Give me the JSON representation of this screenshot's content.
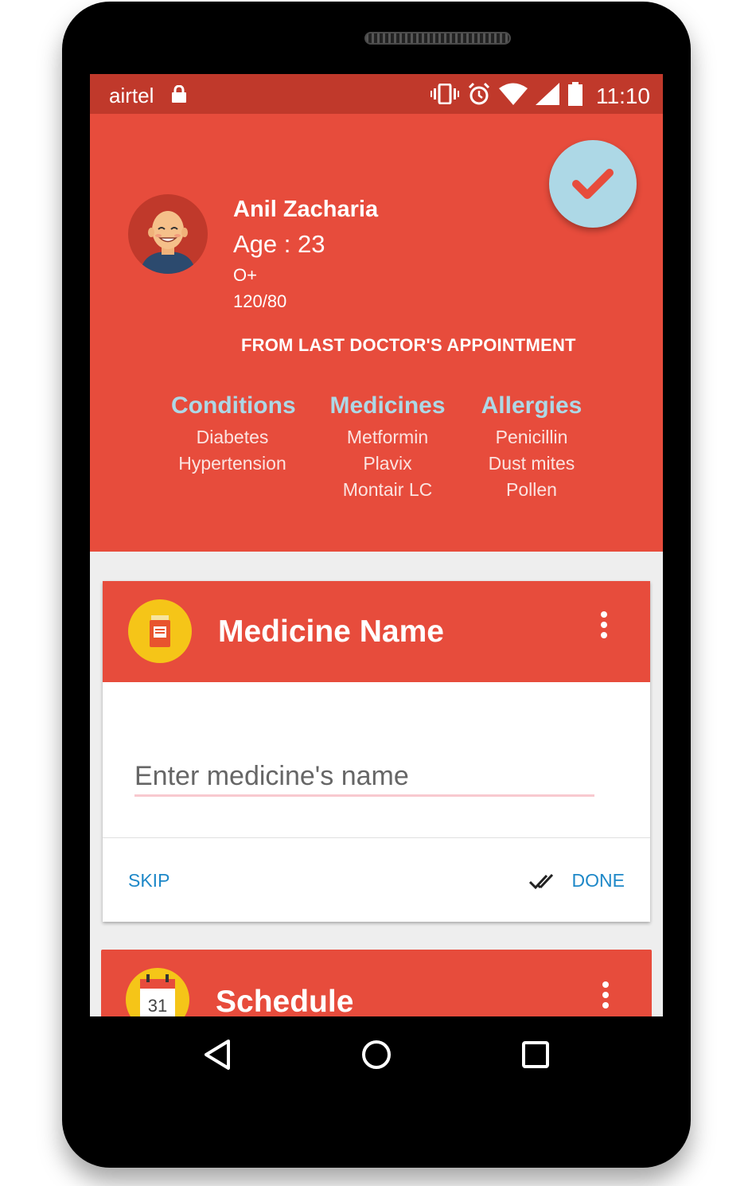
{
  "status_bar": {
    "carrier": "airtel",
    "time": "11:10",
    "icons": [
      "lock-icon",
      "vibrate-icon",
      "alarm-icon",
      "wifi-icon",
      "signal-icon",
      "battery-icon"
    ]
  },
  "profile": {
    "name": "Anil Zacharia",
    "age": "Age : 23",
    "blood_group": "O+",
    "blood_pressure": "120/80",
    "section_label": "FROM LAST DOCTOR'S APPOINTMENT"
  },
  "summary": {
    "conditions": {
      "title": "Conditions",
      "items": [
        "Diabetes",
        "Hypertension"
      ]
    },
    "medicines": {
      "title": "Medicines",
      "items": [
        "Metformin",
        "Plavix",
        "Montair LC"
      ]
    },
    "allergies": {
      "title": "Allergies",
      "items": [
        "Penicillin",
        "Dust mites",
        "Pollen"
      ]
    }
  },
  "medicine_card": {
    "title": "Medicine Name",
    "input_placeholder": "Enter medicine's name",
    "input_value": "",
    "skip_label": "SKIP",
    "done_label": "DONE"
  },
  "schedule_card": {
    "title": "Schedule",
    "calendar_day": "31"
  },
  "colors": {
    "primary": "#e74c3c",
    "status_bar": "#c0392b",
    "accent": "#add8e6",
    "action_text": "#1e88c8",
    "icon_bg": "#f5c518"
  }
}
